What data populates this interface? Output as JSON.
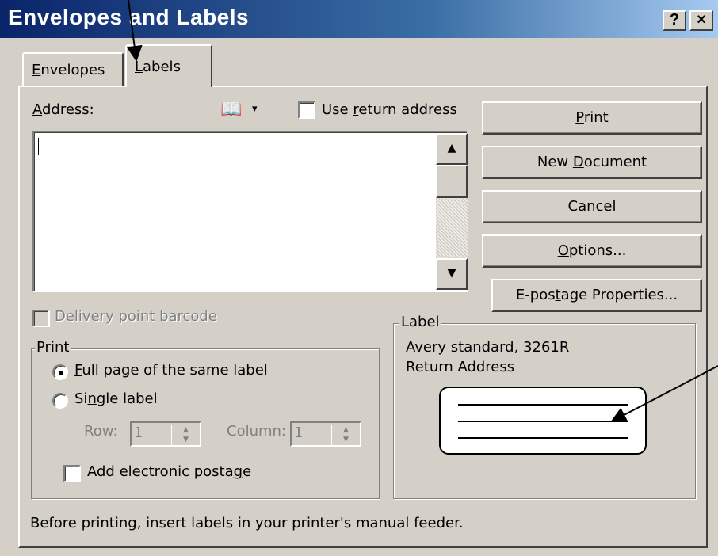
{
  "window": {
    "title": "Envelopes and Labels",
    "help_glyph": "?",
    "close_glyph": "×"
  },
  "tabs": [
    {
      "label": "Envelopes",
      "mnemonic": "E",
      "rest": "nvelopes",
      "selected": false
    },
    {
      "label": "Labels",
      "mnemonic": "L",
      "rest": "abels",
      "selected": true
    }
  ],
  "address": {
    "label_mn": "A",
    "label_rest": "ddress:",
    "value": "",
    "book_glyph": "📖",
    "dropdown_glyph": "▾",
    "use_return": {
      "pre": "Use ",
      "mn": "r",
      "post": "eturn address",
      "checked": false
    },
    "scroll_up_glyph": "▲",
    "scroll_down_glyph": "▼"
  },
  "buttons": {
    "print": {
      "mn": "P",
      "rest": "rint"
    },
    "new_document": {
      "pre": "New ",
      "mn": "D",
      "rest": "ocument"
    },
    "cancel": "Cancel",
    "options": {
      "mn": "O",
      "rest": "ptions..."
    },
    "epostage": {
      "pre": "E-pos",
      "mn": "t",
      "rest": "age Properties..."
    }
  },
  "delivery_barcode": {
    "label": "Delivery point barcode",
    "checked": false,
    "enabled": false
  },
  "print_group": {
    "title": "Print",
    "full_page": {
      "mn": "F",
      "rest": "ull page of the same label",
      "selected": true
    },
    "single": {
      "pre": "Si",
      "mn": "n",
      "rest": "gle label",
      "selected": false
    },
    "row_label": "Row:",
    "row_value": "1",
    "column_label": "Column:",
    "column_value": "1",
    "spin_up": "▲",
    "spin_down": "▼",
    "add_postage": {
      "pre": "Add electronic posta",
      "mn": "g",
      "rest": "e",
      "checked": false
    }
  },
  "label_group": {
    "title": "Label",
    "line1": "Avery standard, 3261R",
    "line2": "Return Address"
  },
  "footer": "Before printing, insert labels in your printer's manual feeder."
}
